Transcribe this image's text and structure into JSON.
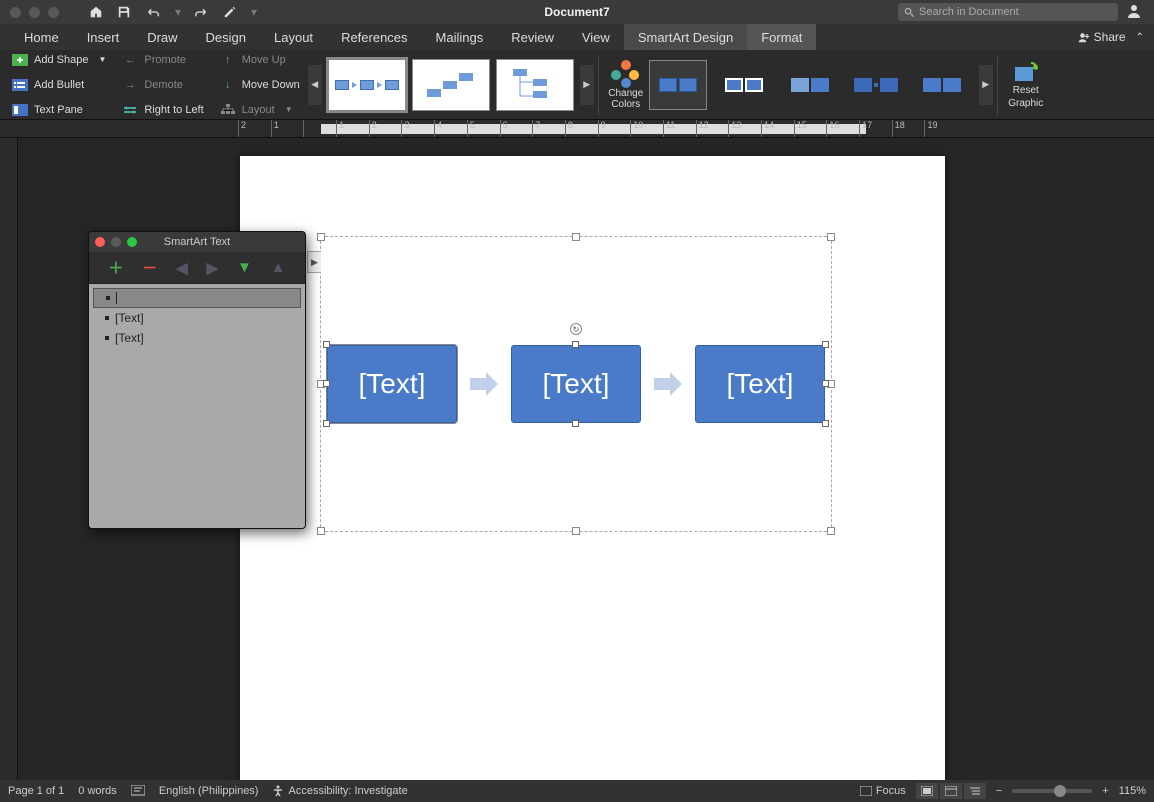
{
  "titlebar": {
    "document_title": "Document7",
    "search_placeholder": "Search in Document"
  },
  "ribbon_tabs": {
    "tabs": [
      "Home",
      "Insert",
      "Draw",
      "Design",
      "Layout",
      "References",
      "Mailings",
      "Review",
      "View"
    ],
    "context_tabs": [
      "SmartArt Design",
      "Format"
    ],
    "active": "SmartArt Design",
    "share_label": "Share"
  },
  "ribbon": {
    "create": {
      "add_shape": "Add Shape",
      "add_bullet": "Add Bullet",
      "text_pane": "Text Pane",
      "promote": "Promote",
      "demote": "Demote",
      "right_to_left": "Right to Left",
      "move_up": "Move Up",
      "move_down": "Move Down",
      "layout": "Layout"
    },
    "change_colors": "Change Colors",
    "reset": {
      "line1": "Reset",
      "line2": "Graphic"
    }
  },
  "ruler": {
    "marks": [
      "2",
      "1",
      "",
      "1",
      "2",
      "3",
      "4",
      "5",
      "6",
      "7",
      "8",
      "9",
      "10",
      "11",
      "12",
      "13",
      "14",
      "15",
      "16",
      "17",
      "18",
      "19"
    ]
  },
  "smartart": {
    "boxes": [
      "[Text]",
      "[Text]",
      "[Text]"
    ]
  },
  "text_panel": {
    "title": "SmartArt Text",
    "items": [
      "",
      "[Text]",
      "[Text]"
    ]
  },
  "statusbar": {
    "page": "Page 1 of 1",
    "words": "0 words",
    "language": "English (Philippines)",
    "accessibility": "Accessibility: Investigate",
    "focus": "Focus",
    "zoom": "115%"
  }
}
